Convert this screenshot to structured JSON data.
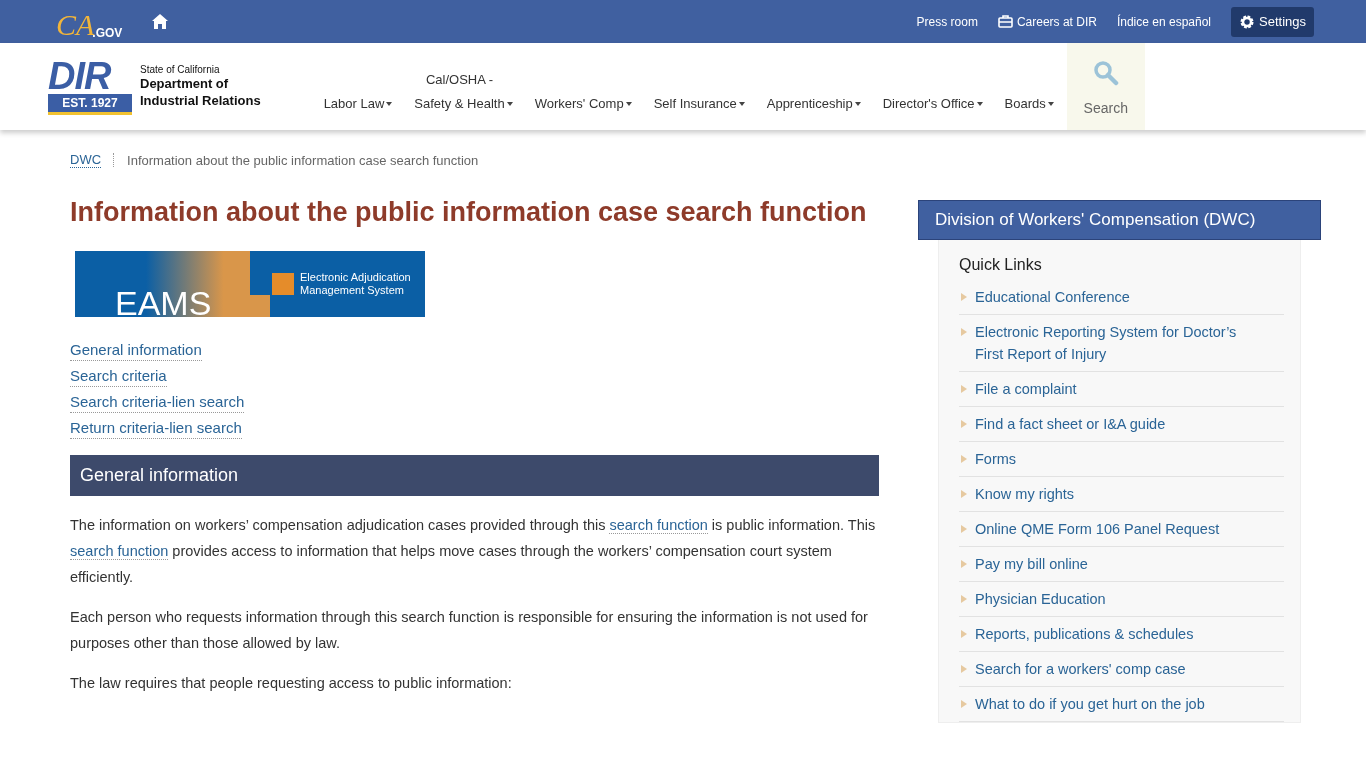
{
  "top_bar": {
    "logo": {
      "letters": "CA",
      "suffix": ".GOV"
    },
    "links": [
      {
        "label": "Press room",
        "kind": "plain"
      },
      {
        "label": "Careers at DIR",
        "kind": "briefcase"
      },
      {
        "label": "Índice en español",
        "kind": "plain"
      }
    ],
    "settings": {
      "label": "Settings"
    }
  },
  "header": {
    "logo": {
      "mark": "DIR",
      "est": "EST. 1927",
      "state": "State of California",
      "name_line_1": "Department of",
      "name_line_2": "Industrial Relations"
    },
    "nav": [
      {
        "label": "Labor Law"
      },
      {
        "label": "Cal/OSHA -\nSafety & Health"
      },
      {
        "label": "Workers' Comp"
      },
      {
        "label": "Self Insurance"
      },
      {
        "label": "Apprenticeship"
      },
      {
        "label": "Director's Office"
      },
      {
        "label": "Boards"
      }
    ],
    "search": {
      "label": "Search"
    }
  },
  "breadcrumb": [
    "DWC",
    "Information about the public information case search function"
  ],
  "main": {
    "title": "Information about the public information case search function",
    "banner": {
      "word": "EAMS",
      "line_1": "Electronic Adjudication",
      "line_2": "Management System"
    },
    "toc": [
      "General information",
      "Search criteria",
      "Search criteria-lien search",
      "Return criteria-lien search"
    ],
    "section_heading": "General information",
    "paragraphs": [
      [
        {
          "text": "The information on workers’ compensation adjudication cases provided through this "
        },
        {
          "link": "search function"
        },
        {
          "text": " is public information. This "
        },
        {
          "link": "search function"
        },
        {
          "text": " provides access to information that helps move cases through the workers’ compensation court system efficiently."
        }
      ],
      [
        {
          "text": "Each person who requests information through this search function is responsible for ensuring the information is not used for purposes other than those allowed by law."
        }
      ],
      [
        {
          "text": "The law requires that people requesting access to public information:"
        }
      ]
    ]
  },
  "sidebar": {
    "title": "Division of Workers' Compensation (DWC)",
    "heading": "Quick Links",
    "links": [
      "Educational Conference",
      "Electronic Reporting System for Doctor’s\n First Report of Injury",
      "File a complaint",
      "Find a fact sheet or I&A guide",
      "Forms",
      "Know my rights",
      "Online QME Form 106 Panel Request",
      "Pay my bill online",
      "Physician Education",
      "Reports, publications & schedules",
      "Search for a workers' comp case",
      "What to do if you get hurt on the job"
    ]
  }
}
